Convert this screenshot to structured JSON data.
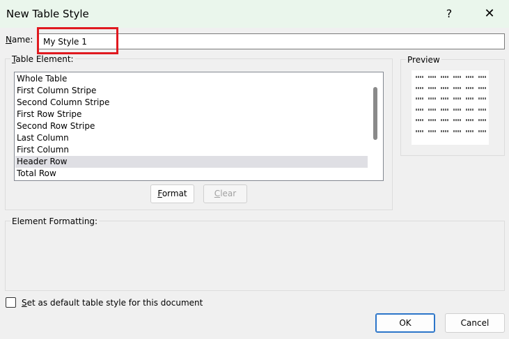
{
  "window": {
    "title": "New Table Style",
    "help_glyph": "?",
    "close_glyph": "✕"
  },
  "name_field": {
    "label_accel": "N",
    "label_rest": "ame:",
    "value": "My Style 1"
  },
  "table_element": {
    "legend_accel": "T",
    "legend_rest": "able Element:",
    "items": [
      "Whole Table",
      "First Column Stripe",
      "Second Column Stripe",
      "First Row Stripe",
      "Second Row Stripe",
      "Last Column",
      "First Column",
      "Header Row",
      "Total Row"
    ],
    "selected_item": "Header Row",
    "format_accel": "F",
    "format_rest": "ormat",
    "clear_accel": "C",
    "clear_rest": "lear"
  },
  "preview": {
    "legend": "Preview",
    "dash_color": "#6a6a6a"
  },
  "element_formatting": {
    "legend": "Element Formatting:"
  },
  "default_checkbox": {
    "label_accel": "S",
    "label_rest": "et as default table style for this document",
    "checked": false
  },
  "footer": {
    "ok_label": "OK",
    "cancel_label": "Cancel"
  },
  "colors": {
    "titlebar_bg": "#eaf6ec",
    "highlight": "#e0191f",
    "selection_bg": "#dfdfe4",
    "default_button_border": "#2b75c9"
  }
}
